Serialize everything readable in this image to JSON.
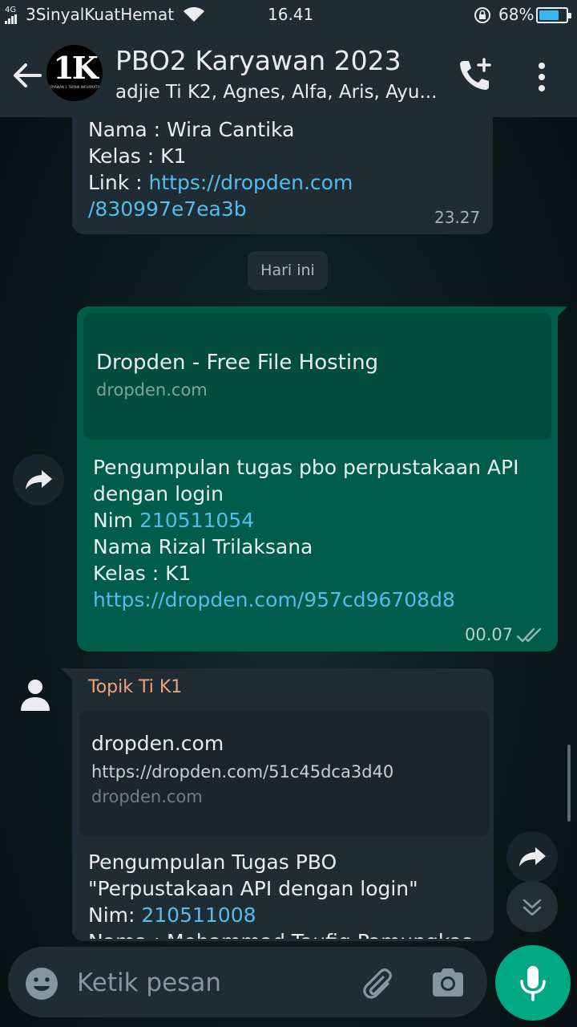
{
  "status_bar": {
    "network": "4G",
    "carrier": "3SinyalKuatHemat",
    "time": "16.41",
    "battery_percent": "68%",
    "battery_level": 0.68
  },
  "header": {
    "title": "PBO2 Karyawan 2023",
    "subtitle": "adjie Ti K2, Agnes, Alfa, Aris, Ayu...",
    "avatar_logo": "1K",
    "avatar_logo_sub": "KARYAWAN 1 TEKNIK INFORMATIKA"
  },
  "messages": {
    "m1": {
      "lines": [
        "Nama : Wira Cantika",
        "Kelas : K1"
      ],
      "link_label": "Link : ",
      "link_line1": "https://dropden.com",
      "link_line2": "/830997e7ea3b",
      "time": "23.27"
    },
    "day_separator": "Hari ini",
    "m2": {
      "preview_title": "Dropden - Free File Hosting",
      "preview_domain": "dropden.com",
      "line1": "Pengumpulan tugas pbo perpustakaan API",
      "line2": "dengan login",
      "nim_label": "Nim ",
      "nim_value": "210511054",
      "nama": "Nama Rizal Trilaksana",
      "kelas": "Kelas : K1",
      "link": "https://dropden.com/957cd96708d8",
      "time": "00.07"
    },
    "m3": {
      "sender": "Topik Ti K1",
      "preview_title": "dropden.com",
      "preview_url": "https://dropden.com/51c45dca3d40",
      "preview_domain": "dropden.com",
      "line1": "Pengumpulan Tugas PBO",
      "line2": "\"Perpustakaan API dengan login\"",
      "nim_label": "Nim: ",
      "nim_value": "210511008",
      "nama_partial": "Nama : Mohammad Taufiq Pamungkas"
    }
  },
  "composer": {
    "placeholder": "Ketik pesan"
  },
  "colors": {
    "header_bg": "#1f2c34",
    "incoming_bubble": "#1f2c34",
    "outgoing_bubble": "#005c4b",
    "link": "#53bdeb",
    "sender_name": "#f2a178",
    "mic_button": "#00a884"
  },
  "icons": [
    "back-arrow-icon",
    "add-call-icon",
    "more-vert-icon",
    "forward-icon",
    "person-icon",
    "double-check-icon",
    "chevrons-down-icon",
    "emoji-icon",
    "paperclip-icon",
    "camera-icon",
    "mic-icon"
  ]
}
